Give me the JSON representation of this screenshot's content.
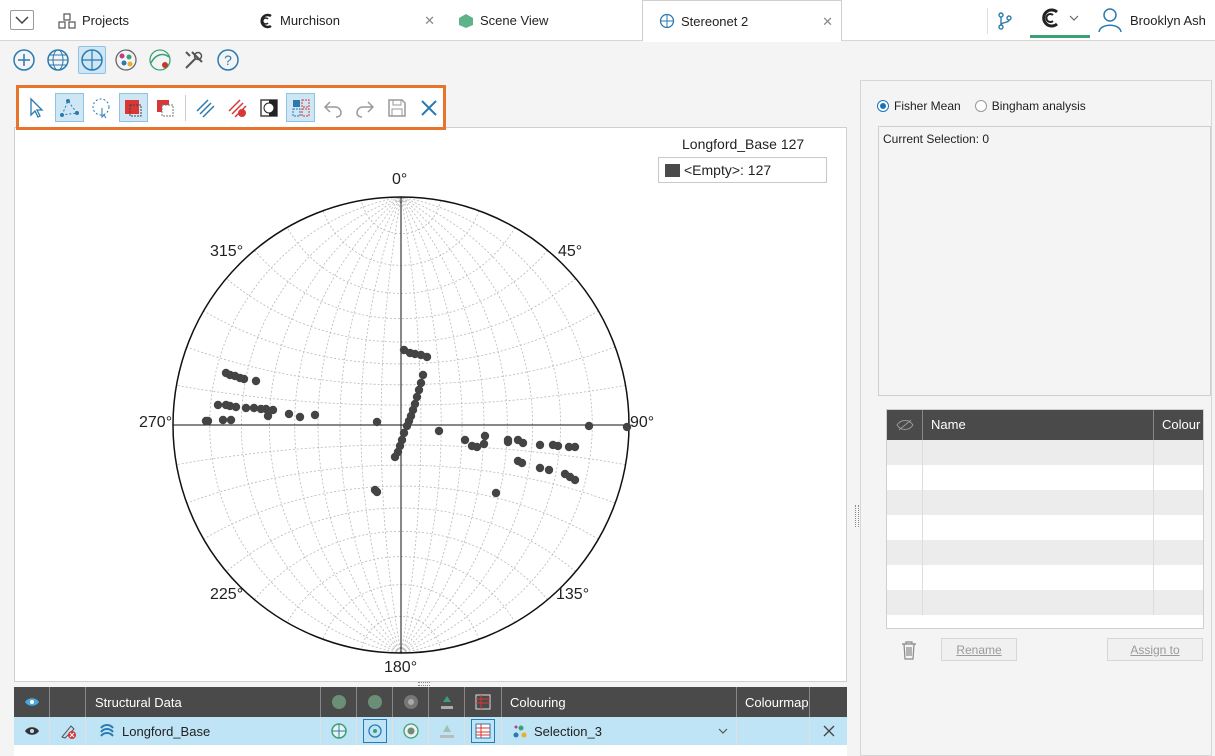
{
  "tabs": {
    "projects": "Projects",
    "murchison": "Murchison",
    "scene_view": "Scene View",
    "stereonet": "Stereonet 2"
  },
  "user": {
    "name": "Brooklyn Ash"
  },
  "plot": {
    "legend_title": "Longford_Base 127",
    "legend_entry": "<Empty>: 127",
    "labels": {
      "n": "0°",
      "ne": "45°",
      "e": "90°",
      "se": "135°",
      "s": "180°",
      "sw": "225°",
      "w": "270°",
      "nw": "315°"
    }
  },
  "bottom_table": {
    "headers": {
      "structural_data": "Structural Data",
      "colouring": "Colouring",
      "colourmap": "Colourmap"
    },
    "row": {
      "name": "Longford_Base",
      "colouring": "Selection_3"
    }
  },
  "right_panel": {
    "fisher": "Fisher Mean",
    "bingham": "Bingham analysis",
    "current_selection": "Current Selection: 0",
    "table_headers": {
      "name": "Name",
      "colour": "Colour"
    },
    "rename": "Rename",
    "assign": "Assign to"
  },
  "colors": {
    "accent": "#e8732a",
    "selection": "#bfe4f6",
    "header": "#4a4a4a",
    "point": "#444444"
  }
}
